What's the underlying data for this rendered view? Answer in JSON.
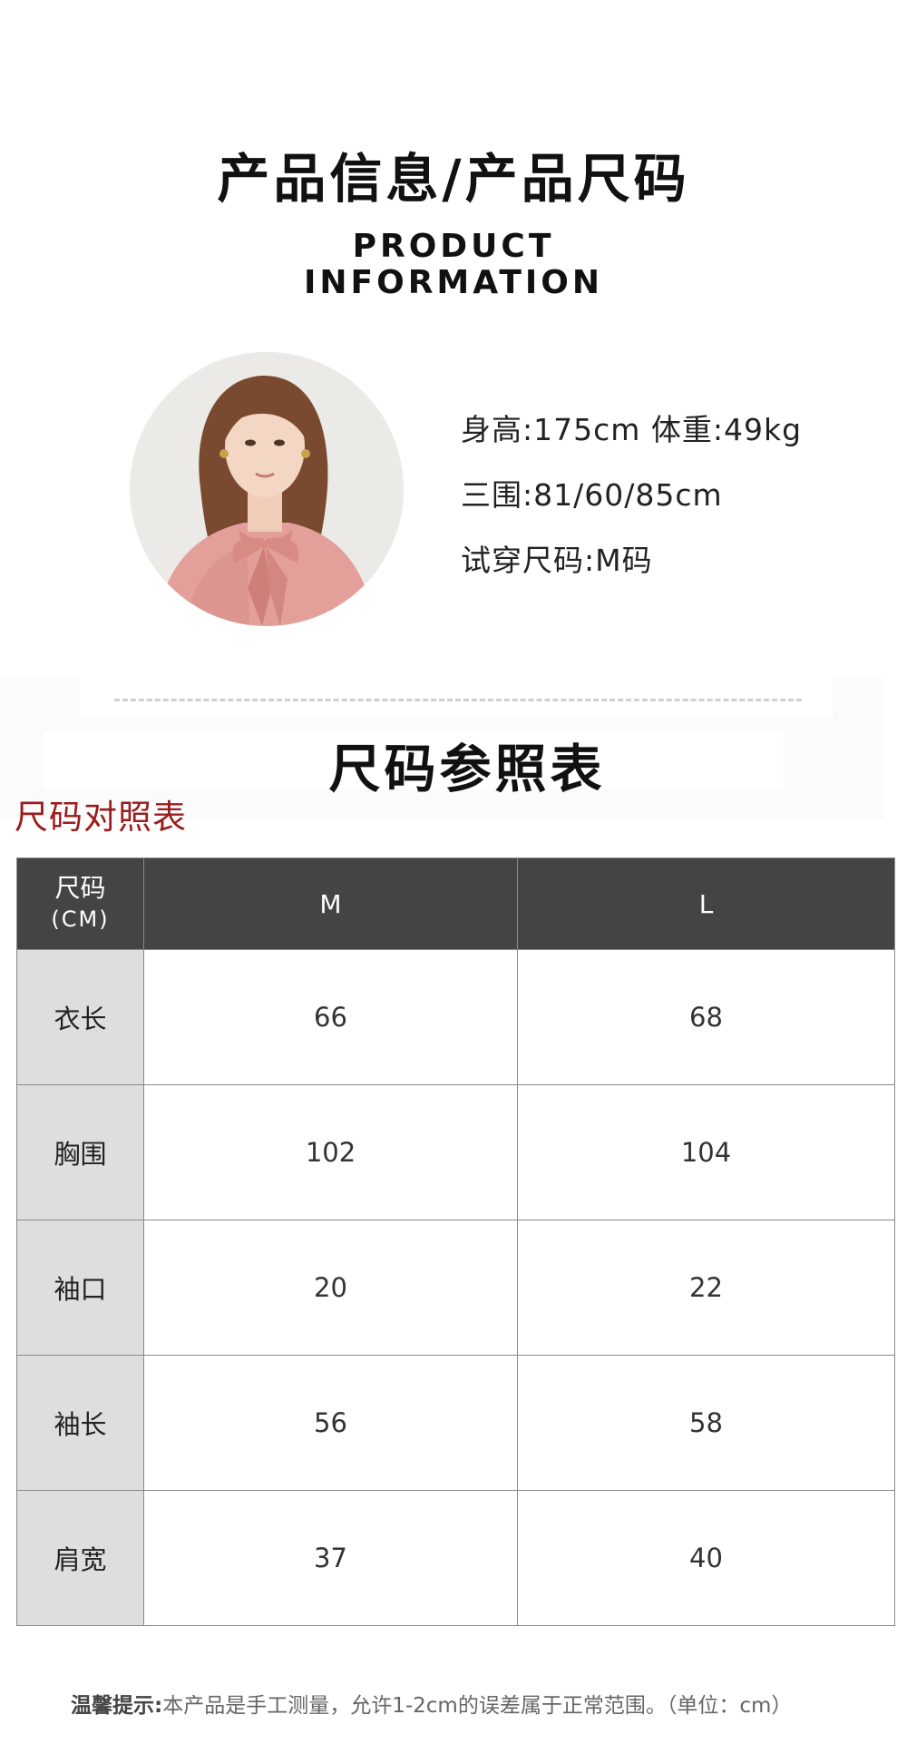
{
  "header": {
    "title_cn": "产品信息/产品尺码",
    "title_en_line1": "PRODUCT",
    "title_en_line2": "INFORMATION"
  },
  "model": {
    "image": "model-portrait",
    "height_weight": "身高:175cm 体重:49kg",
    "measurements": "三围:81/60/85cm",
    "tried_size": "试穿尺码:M码"
  },
  "size_chart": {
    "title": "尺码参照表",
    "caption": "尺码对照表",
    "header_label": "尺码",
    "header_unit": "(CM)",
    "columns": [
      "M",
      "L"
    ],
    "rows": [
      {
        "label": "衣长",
        "values": [
          "66",
          "68"
        ]
      },
      {
        "label": "胸围",
        "values": [
          "102",
          "104"
        ]
      },
      {
        "label": "袖口",
        "values": [
          "20",
          "22"
        ]
      },
      {
        "label": "袖长",
        "values": [
          "56",
          "58"
        ]
      },
      {
        "label": "肩宽",
        "values": [
          "37",
          "40"
        ]
      }
    ]
  },
  "footnote": {
    "prefix": "温馨提示:",
    "text": "本产品是手工测量，允许1-2cm的误差属于正常范围。（单位：cm）"
  },
  "colors": {
    "table_header_bg": "#444444",
    "row_label_bg": "#dedede",
    "caption_red": "#9b1c1c",
    "blouse_pink": "#e3a09a"
  }
}
